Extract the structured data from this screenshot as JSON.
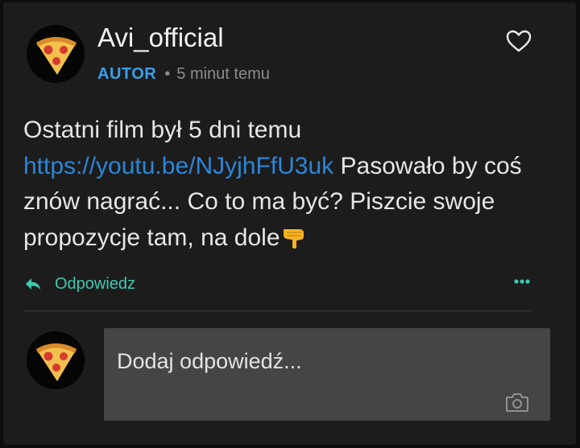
{
  "post": {
    "author": "Avi_official",
    "badge": "AUTOR",
    "separator": "•",
    "time": "5 minut temu",
    "text_before_link": "Ostatni film był 5 dni temu",
    "link": "https://youtu.be/NJyjhFfU3uk",
    "text_after_link": " Pasowało by coś znów nagrać... Co to ma być? Piszcie swoje propozycje tam, na dole",
    "emoji": "pointing-down-hand-emoji"
  },
  "actions": {
    "reply_label": "Odpowiedz",
    "reply_icon": "reply-arrow-icon",
    "more_icon": "more-dots-icon",
    "like_icon": "heart-icon"
  },
  "composer": {
    "placeholder": "Dodaj odpowiedź...",
    "camera_icon": "camera-icon"
  },
  "colors": {
    "background": "#1c1c1c",
    "badge": "#3aa0e8",
    "link": "#2c86d8",
    "accent": "#40c8b0",
    "composer": "#454545"
  }
}
